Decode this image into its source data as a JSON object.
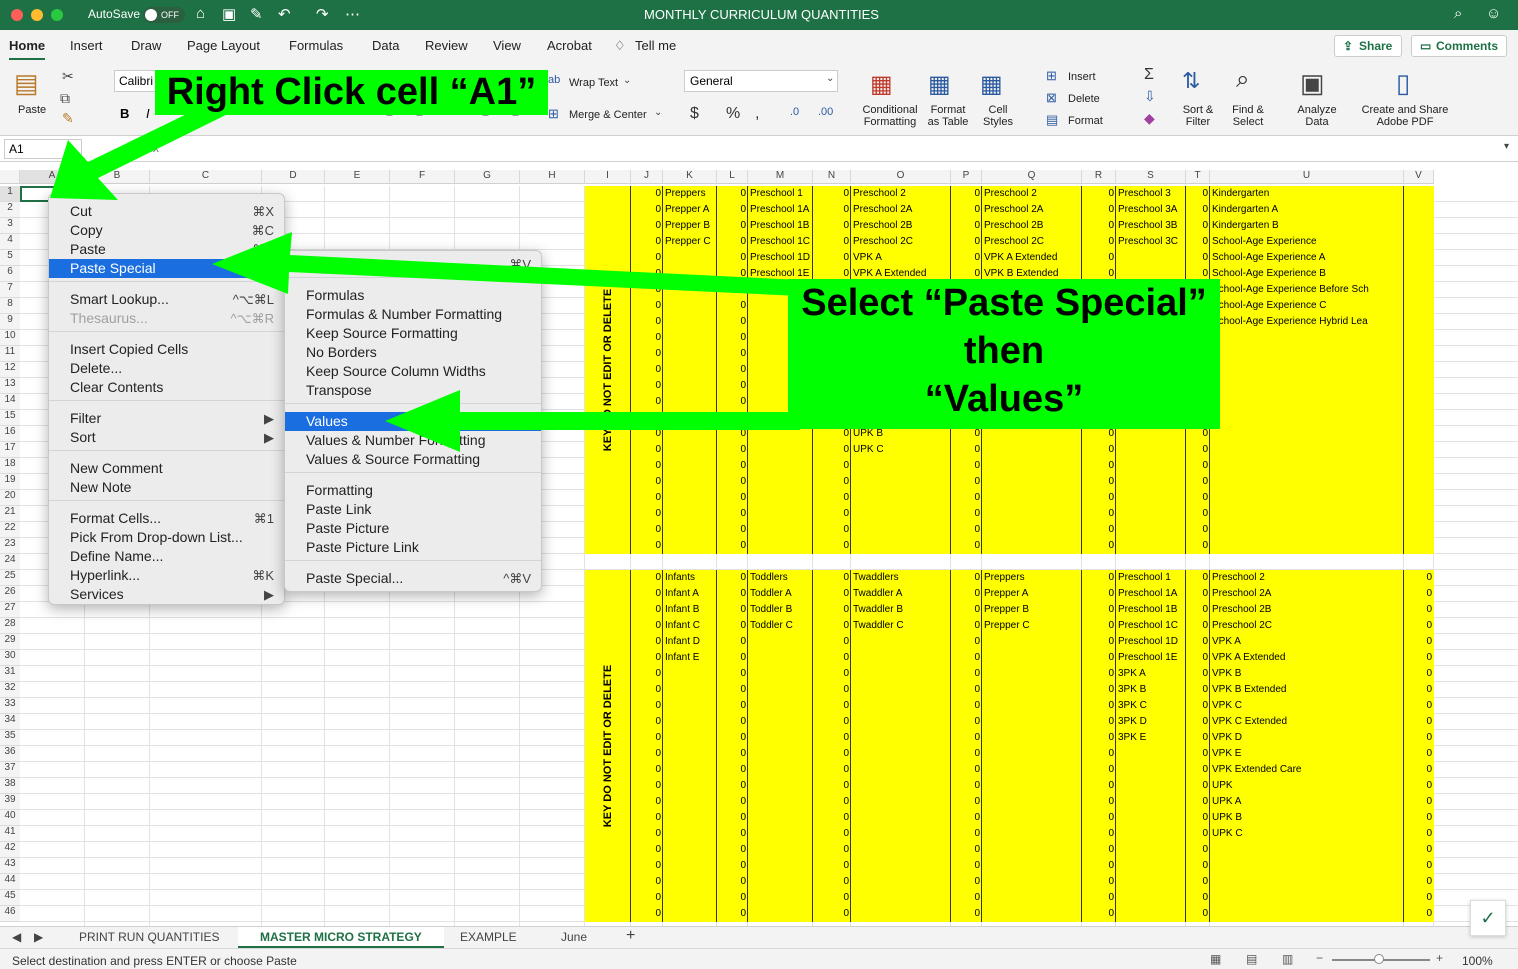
{
  "title": "MONTHLY CURRICULUM QUANTITIES",
  "autosave": {
    "label": "AutoSave",
    "state": "OFF"
  },
  "tabs": [
    "Home",
    "Insert",
    "Draw",
    "Page Layout",
    "Formulas",
    "Data",
    "Review",
    "View",
    "Acrobat"
  ],
  "tell_me": "Tell me",
  "share": "Share",
  "comments": "Comments",
  "ribbon": {
    "paste": "Paste",
    "font": "Calibri",
    "wrap": "Wrap Text",
    "merge": "Merge & Center",
    "number_format": "General",
    "cond": [
      "Conditional",
      "Formatting"
    ],
    "fmt_table": [
      "Format",
      "as Table"
    ],
    "cell_styles": [
      "Cell",
      "Styles"
    ],
    "insert": "Insert",
    "delete": "Delete",
    "format": "Format",
    "sort": [
      "Sort &",
      "Filter"
    ],
    "find": [
      "Find &",
      "Select"
    ],
    "analyze": [
      "Analyze",
      "Data"
    ],
    "adobe": [
      "Create and Share",
      "Adobe PDF"
    ]
  },
  "namebox": "A1",
  "fx": "fx",
  "columns": [
    "A",
    "B",
    "C",
    "D",
    "E",
    "F",
    "G",
    "H",
    "I",
    "J",
    "K",
    "L",
    "M",
    "N",
    "O",
    "P",
    "Q",
    "R",
    "S",
    "T",
    "U",
    "V"
  ],
  "rows_count": 46,
  "key_label": "KEY DO NOT EDIT OR DELETE",
  "top_table": {
    "K": [
      "Preppers",
      "Prepper A",
      "Prepper B",
      "Prepper C"
    ],
    "M": [
      "Preschool 1",
      "Preschool 1A",
      "Preschool 1B",
      "Preschool 1C",
      "Preschool 1D",
      "Preschool 1E"
    ],
    "O": [
      "Preschool 2",
      "Preschool 2A",
      "Preschool 2B",
      "Preschool 2C",
      "VPK A",
      "VPK A Extended"
    ],
    "O_lower": [
      "UPK B",
      "UPK C"
    ],
    "Q": [
      "Preschool 2",
      "Preschool 2A",
      "Preschool 2B",
      "Preschool 2C",
      "VPK A Extended",
      "VPK B Extended"
    ],
    "S": [
      "Preschool 3",
      "Preschool 3A",
      "Preschool 3B",
      "Preschool 3C"
    ],
    "U": [
      "Kindergarten",
      "Kindergarten A",
      "Kindergarten B",
      "School-Age Experience",
      "School-Age Experience A",
      "School-Age Experience B",
      "School-Age Experience Before Sch",
      "School-Age Experience C",
      "School-Age Experience Hybrid Lea"
    ]
  },
  "bottom_table": {
    "K": [
      "Infants",
      "Infant A",
      "Infant B",
      "Infant C",
      "Infant D",
      "Infant E"
    ],
    "M": [
      "Toddlers",
      "Toddler A",
      "Toddler B",
      "Toddler C"
    ],
    "O": [
      "Twaddlers",
      "Twaddler A",
      "Twaddler B",
      "Twaddler C"
    ],
    "Q": [
      "Preppers",
      "Prepper A",
      "Prepper B",
      "Prepper C"
    ],
    "S": [
      "Preschool 1",
      "Preschool 1A",
      "Preschool 1B",
      "Preschool 1C",
      "Preschool 1D",
      "Preschool 1E",
      "3PK A",
      "3PK B",
      "3PK C",
      "3PK D",
      "3PK E"
    ],
    "U": [
      "Preschool 2",
      "Preschool 2A",
      "Preschool 2B",
      "Preschool 2C",
      "VPK A",
      "VPK A Extended",
      "VPK B",
      "VPK B Extended",
      "VPK C",
      "VPK C Extended",
      "VPK D",
      "VPK E",
      "VPK Extended Care",
      "UPK",
      "UPK A",
      "UPK B",
      "UPK C"
    ]
  },
  "zero": "0",
  "context_menu": [
    {
      "label": "Cut",
      "shortcut": "⌘X"
    },
    {
      "label": "Copy",
      "shortcut": "⌘C"
    },
    {
      "label": "Paste",
      "shortcut": "⌘V"
    },
    {
      "label": "Paste Special",
      "shortcut": ""
    },
    {
      "label": "Smart Lookup...",
      "shortcut": "^⌥⌘L"
    },
    {
      "label": "Thesaurus...",
      "shortcut": "^⌥⌘R"
    },
    {
      "label": "Insert Copied Cells",
      "shortcut": ""
    },
    {
      "label": "Delete...",
      "shortcut": ""
    },
    {
      "label": "Clear Contents",
      "shortcut": ""
    },
    {
      "label": "Filter",
      "shortcut": "▶"
    },
    {
      "label": "Sort",
      "shortcut": "▶"
    },
    {
      "label": "New Comment",
      "shortcut": ""
    },
    {
      "label": "New Note",
      "shortcut": ""
    },
    {
      "label": "Format Cells...",
      "shortcut": "⌘1"
    },
    {
      "label": "Pick From Drop-down List...",
      "shortcut": ""
    },
    {
      "label": "Define Name...",
      "shortcut": ""
    },
    {
      "label": "Hyperlink...",
      "shortcut": "⌘K"
    },
    {
      "label": "Services",
      "shortcut": "▶"
    }
  ],
  "submenu": [
    {
      "label": "Paste",
      "shortcut": "⌘V"
    },
    {
      "label": "Formulas",
      "shortcut": ""
    },
    {
      "label": "Formulas & Number Formatting",
      "shortcut": ""
    },
    {
      "label": "Keep Source Formatting",
      "shortcut": ""
    },
    {
      "label": "No Borders",
      "shortcut": ""
    },
    {
      "label": "Keep Source Column Widths",
      "shortcut": ""
    },
    {
      "label": "Transpose",
      "shortcut": ""
    },
    {
      "label": "Values",
      "shortcut": ""
    },
    {
      "label": "Values & Number Formatting",
      "shortcut": ""
    },
    {
      "label": "Values & Source Formatting",
      "shortcut": ""
    },
    {
      "label": "Formatting",
      "shortcut": ""
    },
    {
      "label": "Paste Link",
      "shortcut": ""
    },
    {
      "label": "Paste Picture",
      "shortcut": ""
    },
    {
      "label": "Paste Picture Link",
      "shortcut": ""
    },
    {
      "label": "Paste Special...",
      "shortcut": "^⌘V"
    }
  ],
  "callouts": {
    "one": "Right Click cell “A1”",
    "two_a": "Select “Paste Special”",
    "two_b": "then",
    "two_c": "“Values”"
  },
  "sheet_tabs": [
    "PRINT RUN QUANTITIES",
    "MASTER MICRO STRATEGY",
    "EXAMPLE",
    "June"
  ],
  "active_sheet": "MASTER MICRO STRATEGY",
  "status": "Select destination and press ENTER or choose Paste",
  "zoom": "100%"
}
